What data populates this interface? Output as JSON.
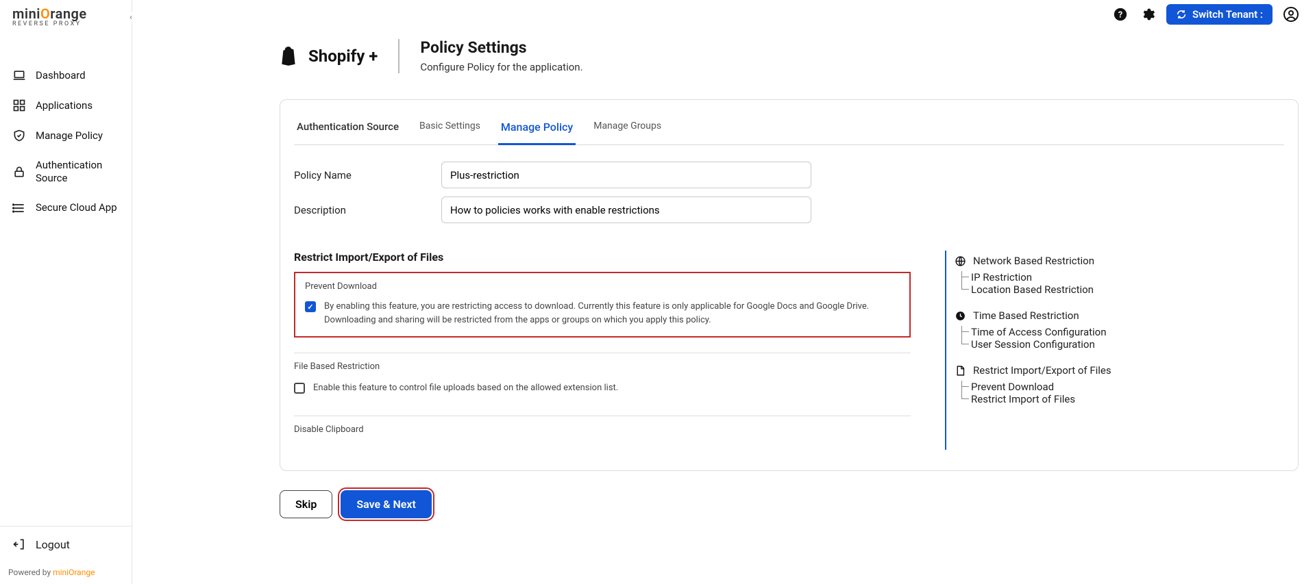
{
  "brand": {
    "name_pre": "mini",
    "name_post": "range",
    "sub": "REVERSE PROXY"
  },
  "sidebar": {
    "items": [
      {
        "label": "Dashboard"
      },
      {
        "label": "Applications"
      },
      {
        "label": "Manage Policy"
      },
      {
        "label": "Authentication Source"
      },
      {
        "label": "Secure Cloud App"
      }
    ],
    "logout": "Logout",
    "powered_pre": "Powered by ",
    "powered_link": "miniOrange"
  },
  "topbar": {
    "tenant_label": "Switch Tenant :"
  },
  "header": {
    "app_name": "Shopify +",
    "title": "Policy Settings",
    "subtitle": "Configure Policy for the application."
  },
  "tabs": [
    {
      "label": "Authentication Source"
    },
    {
      "label": "Basic Settings"
    },
    {
      "label": "Manage Policy",
      "active": true
    },
    {
      "label": "Manage Groups"
    }
  ],
  "form": {
    "policy_name_label": "Policy Name",
    "policy_name_value": "Plus-restriction",
    "description_label": "Description",
    "description_value": "How to policies works with enable restrictions"
  },
  "sections": {
    "restrict_title": "Restrict Import/Export of Files",
    "prevent_head": "Prevent Download",
    "prevent_text": "By enabling this feature, you are restricting access to download. Currently this feature is only applicable for Google Docs and Google Drive. Downloading and sharing will be restricted from the apps or groups on which you apply this policy.",
    "file_head": "File Based Restriction",
    "file_text": "Enable this feature to control file uploads based on the allowed extension list.",
    "clipboard_head": "Disable Clipboard"
  },
  "rightnav": {
    "network": "Network Based Restriction",
    "ip": "IP Restriction",
    "location": "Location Based Restriction",
    "time": "Time Based Restriction",
    "time_access": "Time of Access Configuration",
    "session": "User Session Configuration",
    "restrict": "Restrict Import/Export of Files",
    "prevent": "Prevent Download",
    "importfiles": "Restrict Import of Files"
  },
  "buttons": {
    "skip": "Skip",
    "save": "Save & Next"
  }
}
